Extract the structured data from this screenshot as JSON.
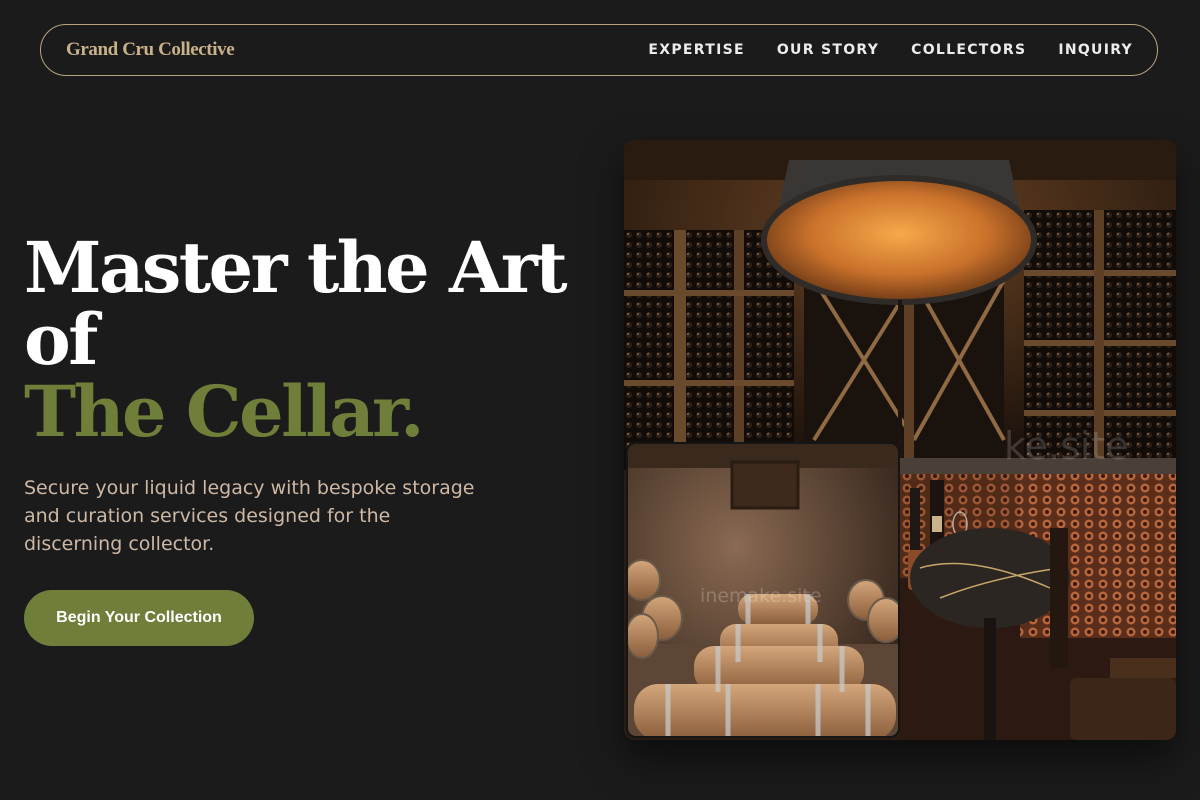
{
  "nav": {
    "brand": "Grand Cru Collective",
    "links": [
      "EXPERTISE",
      "OUR STORY",
      "COLLECTORS",
      "INQUIRY"
    ]
  },
  "hero": {
    "title_line1": "Master the Art",
    "title_line2": "of",
    "title_accent": "The Cellar.",
    "lede": "Secure your liquid legacy with bespoke storage and curation services designed for the discerning collector.",
    "cta_label": "Begin Your Collection"
  },
  "gallery": {
    "watermark_main": "ke.site",
    "watermark_barrels": "inemake.site"
  },
  "colors": {
    "background": "#1b1b1b",
    "brand_gold": "#c8b28a",
    "accent_olive": "#6f7f3a",
    "body_text": "#cdb8a5"
  }
}
